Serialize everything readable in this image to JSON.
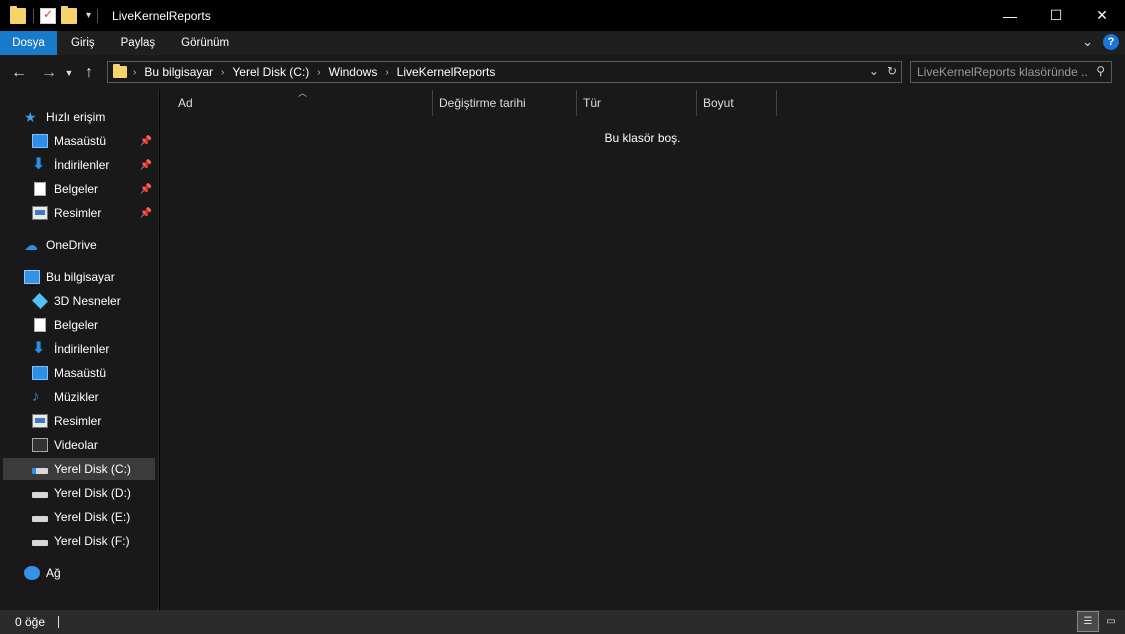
{
  "window": {
    "title": "LiveKernelReports",
    "minimize": "—",
    "maximize": "☐",
    "close": "✕"
  },
  "ribbon": {
    "tabs": [
      "Dosya",
      "Giriş",
      "Paylaş",
      "Görünüm"
    ],
    "active_tab": "Dosya",
    "help": "?"
  },
  "address": {
    "crumbs": [
      "Bu bilgisayar",
      "Yerel Disk (C:)",
      "Windows",
      "LiveKernelReports"
    ]
  },
  "search": {
    "placeholder": "LiveKernelReports klasöründe ..."
  },
  "sidebar": {
    "quick_access": {
      "label": "Hızlı erişim",
      "items": [
        "Masaüstü",
        "İndirilenler",
        "Belgeler",
        "Resimler"
      ]
    },
    "onedrive": "OneDrive",
    "this_pc": {
      "label": "Bu bilgisayar",
      "items": [
        "3D Nesneler",
        "Belgeler",
        "İndirilenler",
        "Masaüstü",
        "Müzikler",
        "Resimler",
        "Videolar",
        "Yerel Disk (C:)",
        "Yerel Disk (D:)",
        "Yerel Disk (E:)",
        "Yerel Disk (F:)"
      ],
      "selected": "Yerel Disk (C:)"
    },
    "network": "Ağ"
  },
  "content": {
    "columns": [
      "Ad",
      "Değiştirme tarihi",
      "Tür",
      "Boyut"
    ],
    "empty_message": "Bu klasör boş."
  },
  "status": {
    "item_count": "0 öğe"
  },
  "colors": {
    "accent": "#1979ca",
    "background": "#191919",
    "titlebar": "#000000",
    "selection": "#3b3b3b"
  }
}
